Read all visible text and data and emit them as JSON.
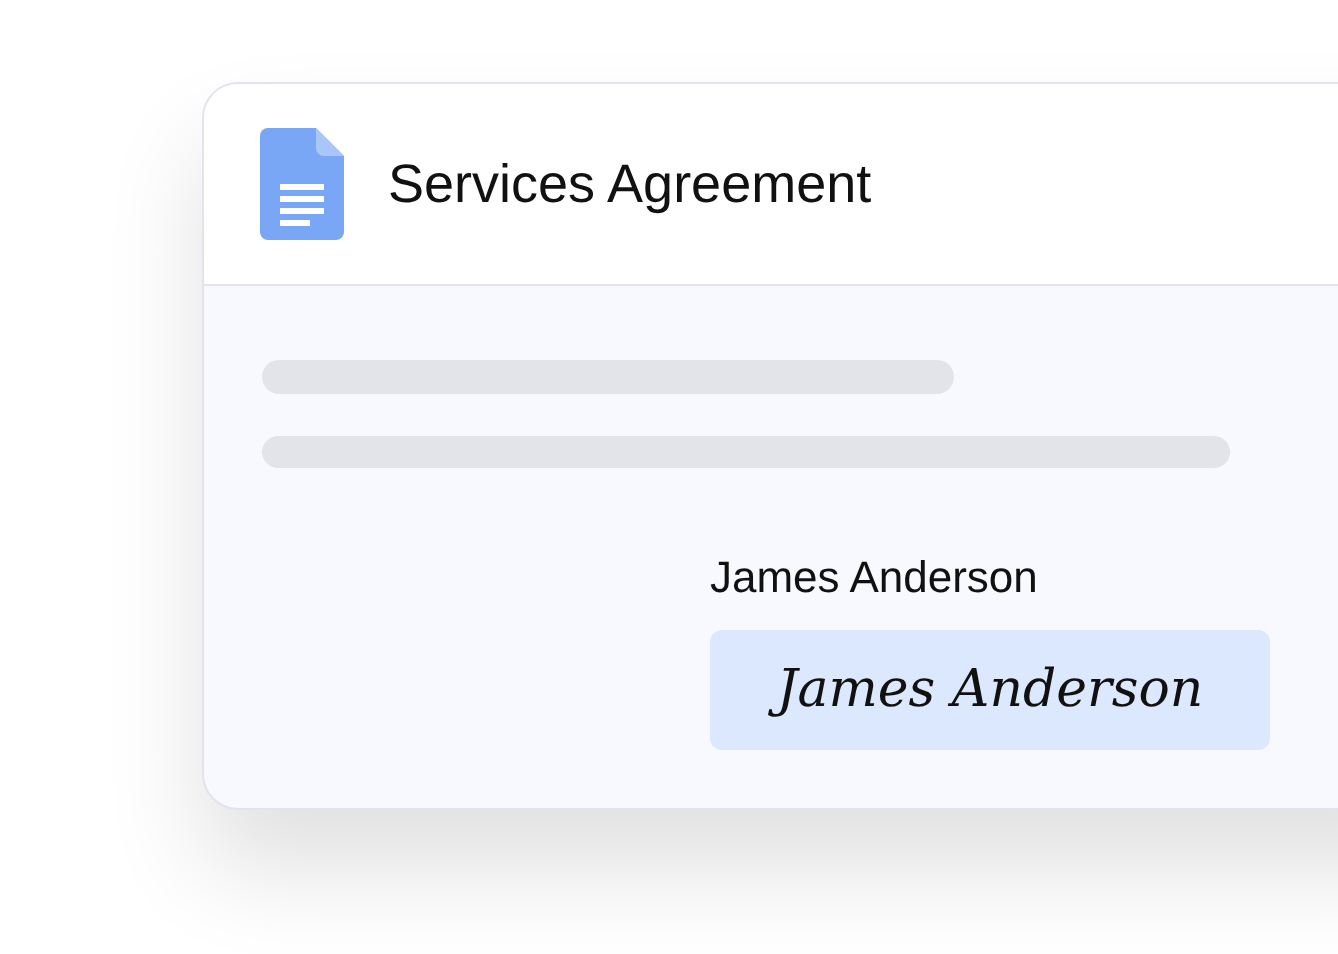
{
  "document": {
    "title": "Services Agreement"
  },
  "signer": {
    "name": "James Anderson",
    "signature": "James Anderson"
  }
}
